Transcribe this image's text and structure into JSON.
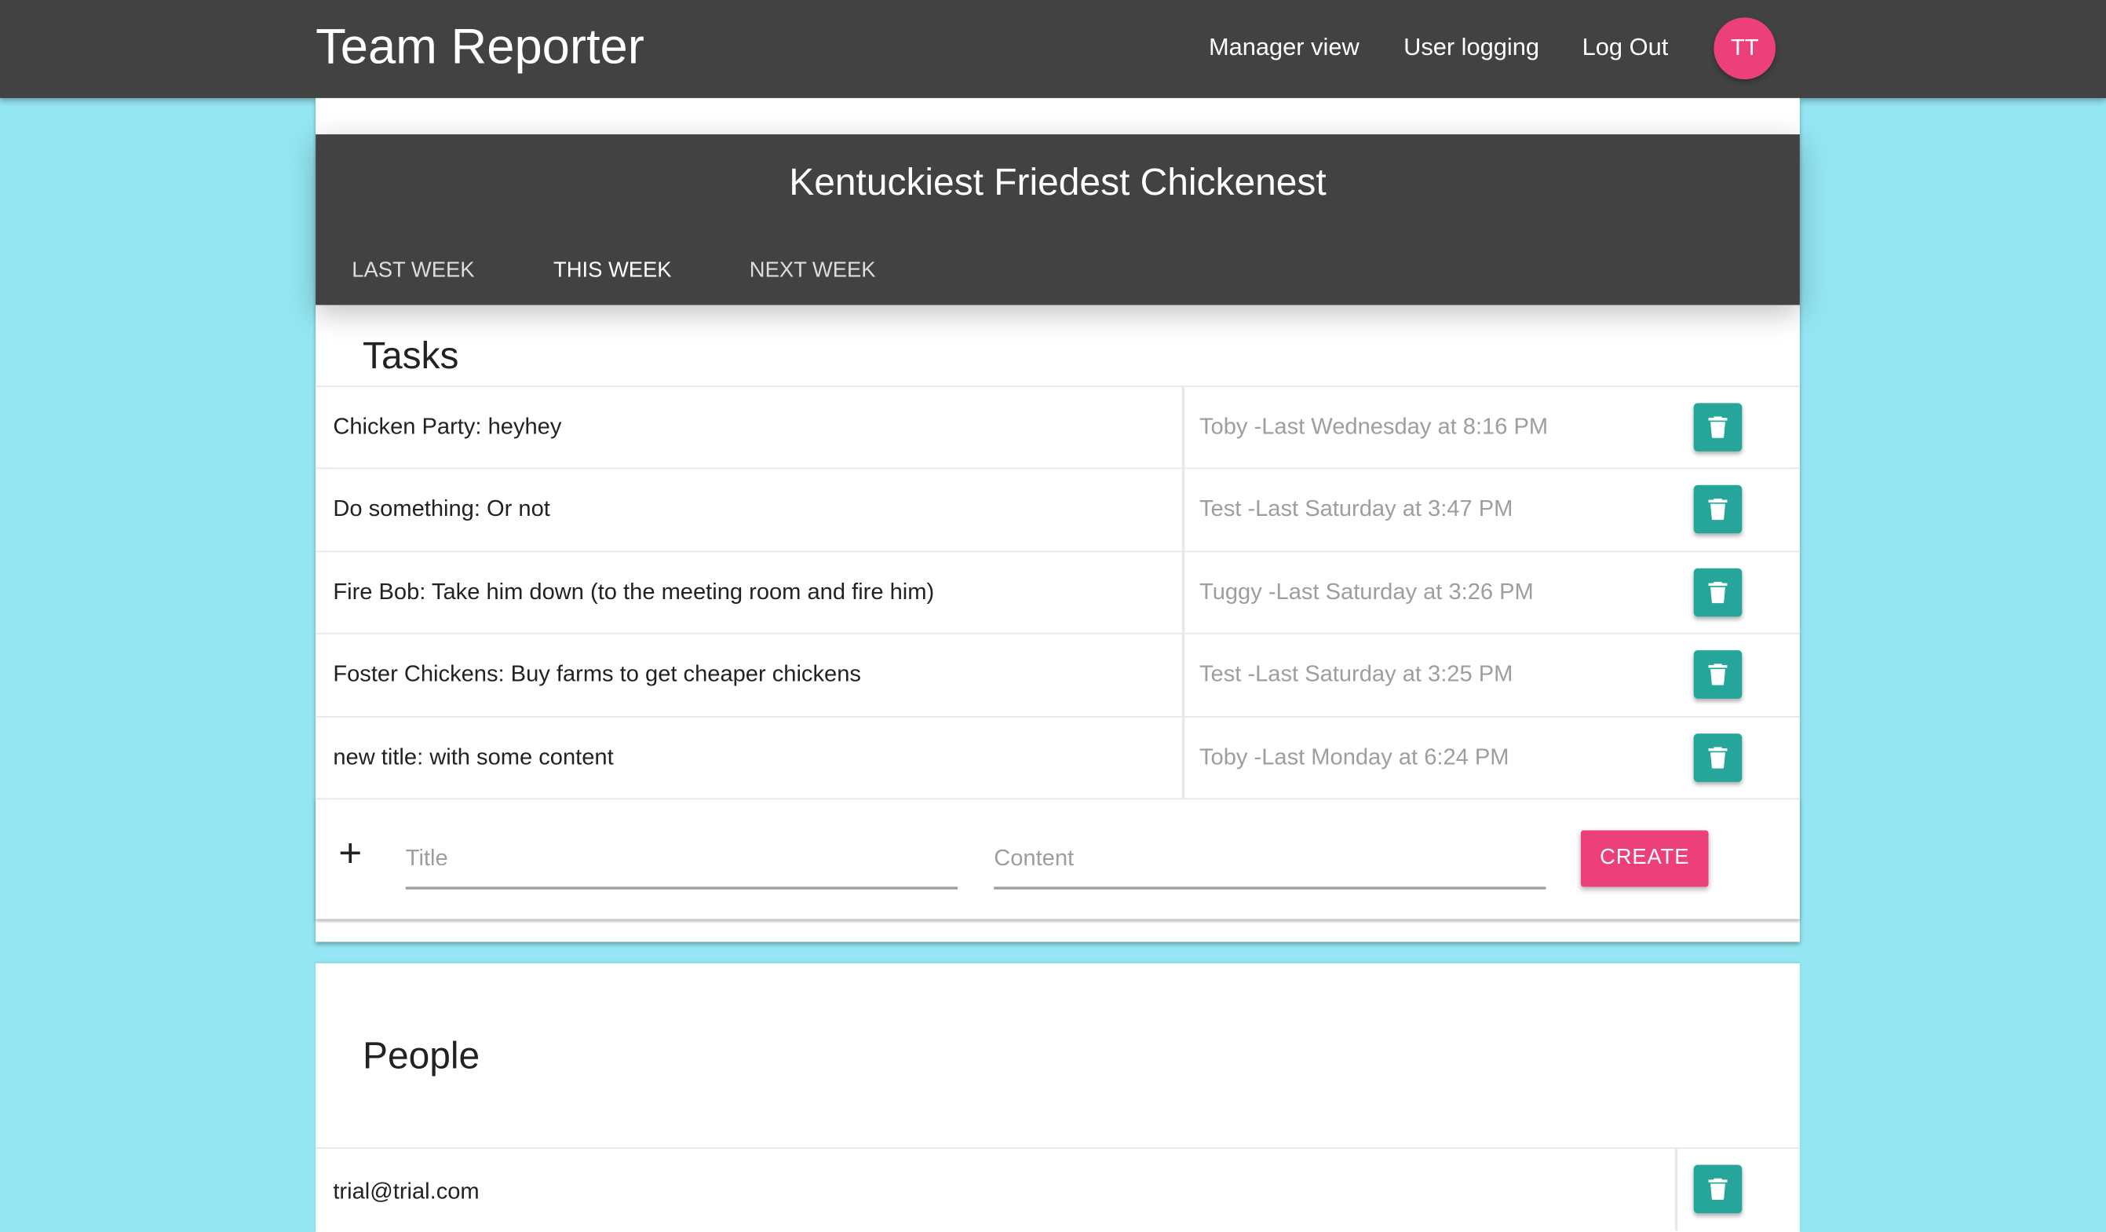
{
  "header": {
    "app_title": "Team Reporter",
    "nav": [
      "Manager view",
      "User logging",
      "Log Out"
    ],
    "avatar_initials": "TT"
  },
  "team": {
    "name": "Kentuckiest Friedest Chickenest",
    "tabs": [
      "LAST WEEK",
      "THIS WEEK",
      "NEXT WEEK"
    ],
    "active_tab": "THIS WEEK"
  },
  "tasks": {
    "title": "Tasks",
    "items": [
      {
        "text": "Chicken Party: heyhey",
        "meta": "Toby -Last Wednesday at 8:16 PM"
      },
      {
        "text": "Do something: Or not",
        "meta": "Test -Last Saturday at 3:47 PM"
      },
      {
        "text": "Fire Bob: Take him down (to the meeting room and fire him)",
        "meta": "Tuggy -Last Saturday at 3:26 PM"
      },
      {
        "text": "Foster Chickens: Buy farms to get cheaper chickens",
        "meta": "Test -Last Saturday at 3:25 PM"
      },
      {
        "text": "new title: with some content",
        "meta": "Toby -Last Monday at 6:24 PM"
      }
    ],
    "create": {
      "title_placeholder": "Title",
      "content_placeholder": "Content",
      "button": "CREATE"
    }
  },
  "people": {
    "title": "People",
    "items": [
      {
        "email": "trial@trial.com"
      }
    ]
  },
  "colors": {
    "topbar": "#424242",
    "background": "#93e6f2",
    "accent": "#ec407a",
    "delete": "#26a69a"
  }
}
